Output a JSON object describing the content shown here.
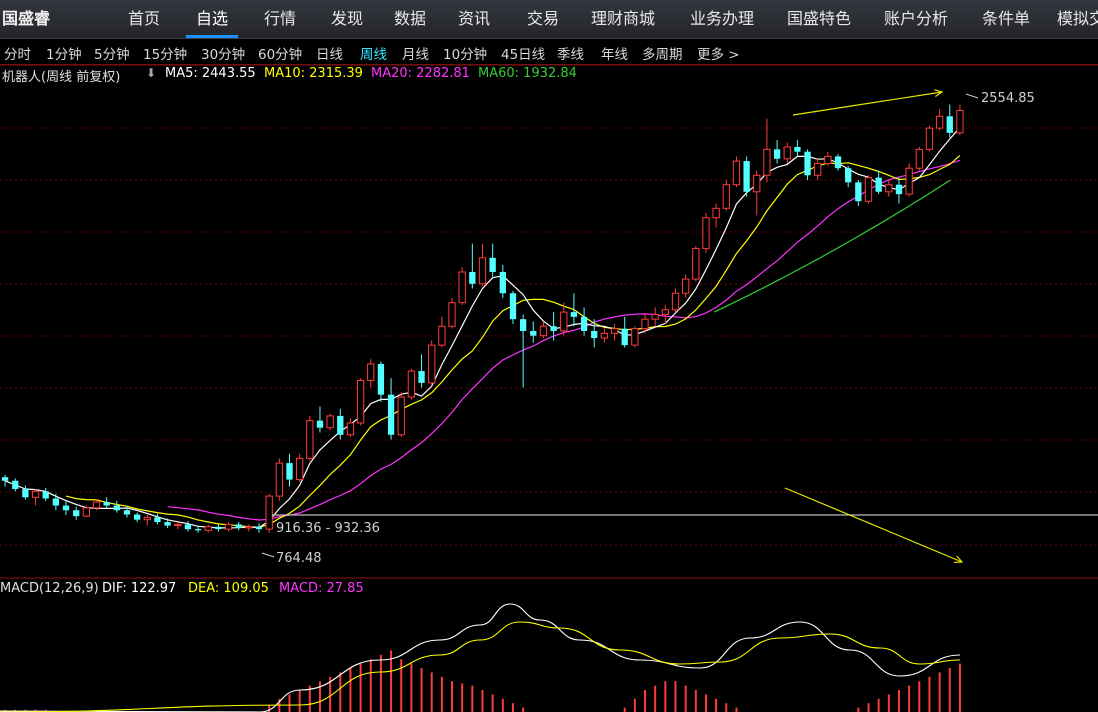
{
  "app": {
    "brand": "国盛睿",
    "nav": [
      "首页",
      "自选",
      "行情",
      "发现",
      "数据",
      "资讯",
      "交易",
      "理财商城",
      "业务办理",
      "国盛特色",
      "账户分析",
      "条件单",
      "模拟交"
    ],
    "nav_active": 1
  },
  "periods": {
    "items": [
      "分时",
      "1分钟",
      "5分钟",
      "15分钟",
      "30分钟",
      "60分钟",
      "日线",
      "周线",
      "月线",
      "10分钟",
      "45日线",
      "季线",
      "年线",
      "多周期",
      "更多"
    ],
    "active": 7
  },
  "indicator_bar": {
    "stock": "机器人(周线 前复权)",
    "ma5": "MA5: 2443.55",
    "ma10": "MA10: 2315.39",
    "ma20": "MA20: 2282.81",
    "ma60": "MA60: 1932.84"
  },
  "macd_bar": {
    "name": "MACD(12,26,9)",
    "dif": "DIF: 122.97",
    "dea": "DEA: 109.05",
    "macd": "MACD: 27.85"
  },
  "annotations": {
    "high": "2554.85",
    "low": "764.48",
    "range": "916.36 - 932.36"
  },
  "colors": {
    "up": "#ff3c3c",
    "down": "#54ffff",
    "ma5": "#ffffff",
    "ma10": "#ffff00",
    "ma20": "#ff33ff",
    "ma60": "#33cc33",
    "grid": "#6a0000",
    "trendline": "#e6e600"
  },
  "chart_data": {
    "type": "candlestick",
    "title": "机器人(周线 前复权)",
    "ylim": [
      700,
      2650
    ],
    "ohlc": [
      [
        1000,
        1010,
        960,
        985
      ],
      [
        985,
        995,
        940,
        950
      ],
      [
        950,
        965,
        905,
        915
      ],
      [
        915,
        950,
        880,
        940
      ],
      [
        940,
        955,
        900,
        910
      ],
      [
        910,
        930,
        860,
        880
      ],
      [
        880,
        900,
        840,
        860
      ],
      [
        860,
        875,
        820,
        835
      ],
      [
        835,
        880,
        830,
        870
      ],
      [
        870,
        905,
        860,
        895
      ],
      [
        895,
        915,
        870,
        880
      ],
      [
        880,
        900,
        850,
        860
      ],
      [
        860,
        875,
        830,
        842
      ],
      [
        842,
        850,
        810,
        820
      ],
      [
        820,
        840,
        795,
        830
      ],
      [
        830,
        845,
        800,
        810
      ],
      [
        810,
        825,
        785,
        795
      ],
      [
        795,
        810,
        780,
        800
      ],
      [
        800,
        815,
        770,
        780
      ],
      [
        780,
        795,
        765,
        775
      ],
      [
        775,
        800,
        765,
        790
      ],
      [
        790,
        800,
        770,
        780
      ],
      [
        780,
        810,
        770,
        800
      ],
      [
        800,
        810,
        775,
        785
      ],
      [
        785,
        800,
        770,
        790
      ],
      [
        790,
        805,
        764.48,
        780
      ],
      [
        780,
        930,
        765,
        920
      ],
      [
        920,
        1080,
        900,
        1060
      ],
      [
        1060,
        1100,
        960,
        990
      ],
      [
        990,
        1100,
        980,
        1080
      ],
      [
        1080,
        1260,
        1070,
        1240
      ],
      [
        1240,
        1300,
        1190,
        1210
      ],
      [
        1210,
        1270,
        1200,
        1260
      ],
      [
        1260,
        1290,
        1160,
        1180
      ],
      [
        1180,
        1250,
        1170,
        1230
      ],
      [
        1230,
        1420,
        1220,
        1410
      ],
      [
        1410,
        1500,
        1380,
        1480
      ],
      [
        1480,
        1490,
        1320,
        1350
      ],
      [
        1350,
        1420,
        1160,
        1180
      ],
      [
        1180,
        1360,
        1170,
        1340
      ],
      [
        1340,
        1460,
        1330,
        1450
      ],
      [
        1450,
        1520,
        1380,
        1400
      ],
      [
        1400,
        1580,
        1390,
        1560
      ],
      [
        1560,
        1680,
        1550,
        1640
      ],
      [
        1640,
        1760,
        1630,
        1740
      ],
      [
        1740,
        1890,
        1730,
        1870
      ],
      [
        1870,
        1990,
        1800,
        1820
      ],
      [
        1820,
        1990,
        1810,
        1930
      ],
      [
        1930,
        1990,
        1850,
        1870
      ],
      [
        1870,
        1900,
        1760,
        1780
      ],
      [
        1780,
        1790,
        1650,
        1670
      ],
      [
        1670,
        1690,
        1380,
        1620
      ],
      [
        1620,
        1660,
        1570,
        1600
      ],
      [
        1600,
        1660,
        1590,
        1640
      ],
      [
        1640,
        1700,
        1580,
        1620
      ],
      [
        1620,
        1740,
        1600,
        1700
      ],
      [
        1700,
        1780,
        1640,
        1680
      ],
      [
        1680,
        1720,
        1600,
        1620
      ],
      [
        1620,
        1670,
        1550,
        1590
      ],
      [
        1590,
        1630,
        1570,
        1610
      ],
      [
        1610,
        1650,
        1580,
        1630
      ],
      [
        1630,
        1680,
        1550,
        1560
      ],
      [
        1560,
        1640,
        1550,
        1630
      ],
      [
        1630,
        1690,
        1610,
        1670
      ],
      [
        1670,
        1720,
        1640,
        1690
      ],
      [
        1690,
        1730,
        1650,
        1710
      ],
      [
        1710,
        1800,
        1700,
        1780
      ],
      [
        1780,
        1860,
        1760,
        1840
      ],
      [
        1840,
        1980,
        1830,
        1970
      ],
      [
        1970,
        2120,
        1950,
        2100
      ],
      [
        2100,
        2160,
        2060,
        2140
      ],
      [
        2140,
        2260,
        2130,
        2240
      ],
      [
        2240,
        2360,
        2230,
        2340
      ],
      [
        2340,
        2360,
        2190,
        2210
      ],
      [
        2210,
        2300,
        2110,
        2280
      ],
      [
        2280,
        2520,
        2250,
        2390
      ],
      [
        2390,
        2430,
        2330,
        2350
      ],
      [
        2350,
        2420,
        2330,
        2400
      ],
      [
        2400,
        2430,
        2360,
        2380
      ],
      [
        2380,
        2390,
        2260,
        2280
      ],
      [
        2280,
        2350,
        2260,
        2330
      ],
      [
        2330,
        2380,
        2320,
        2360
      ],
      [
        2360,
        2370,
        2300,
        2310
      ],
      [
        2310,
        2320,
        2230,
        2250
      ],
      [
        2250,
        2260,
        2150,
        2170
      ],
      [
        2170,
        2280,
        2160,
        2270
      ],
      [
        2270,
        2300,
        2200,
        2210
      ],
      [
        2210,
        2260,
        2190,
        2240
      ],
      [
        2240,
        2270,
        2160,
        2200
      ],
      [
        2200,
        2330,
        2190,
        2310
      ],
      [
        2310,
        2400,
        2300,
        2390
      ],
      [
        2390,
        2490,
        2380,
        2480
      ],
      [
        2480,
        2560,
        2470,
        2530
      ],
      [
        2530,
        2580,
        2440,
        2460
      ],
      [
        2460,
        2580,
        2450,
        2554.85
      ]
    ],
    "ma60_window": [
      0.74,
      0.985
    ],
    "ma60_range": [
      1700,
      2260
    ],
    "macd_hist": [
      1,
      1,
      1,
      1,
      1,
      0,
      0,
      0,
      0,
      0,
      0,
      0,
      0,
      0,
      0,
      0,
      0,
      0,
      0,
      0,
      0,
      0,
      0,
      0,
      0,
      0,
      3,
      6,
      8,
      10,
      12,
      14,
      16,
      18,
      20,
      22,
      24,
      26,
      28,
      24,
      22,
      20,
      18,
      16,
      14,
      13,
      12,
      10,
      8,
      6,
      4,
      2,
      0,
      0,
      0,
      0,
      0,
      0,
      0,
      0,
      0,
      2,
      6,
      10,
      12,
      14,
      14,
      12,
      10,
      8,
      6,
      4,
      2,
      0,
      0,
      0,
      0,
      0,
      0,
      0,
      0,
      0,
      0,
      0,
      2,
      4,
      6,
      8,
      10,
      12,
      14,
      16,
      18,
      20,
      22
    ]
  }
}
